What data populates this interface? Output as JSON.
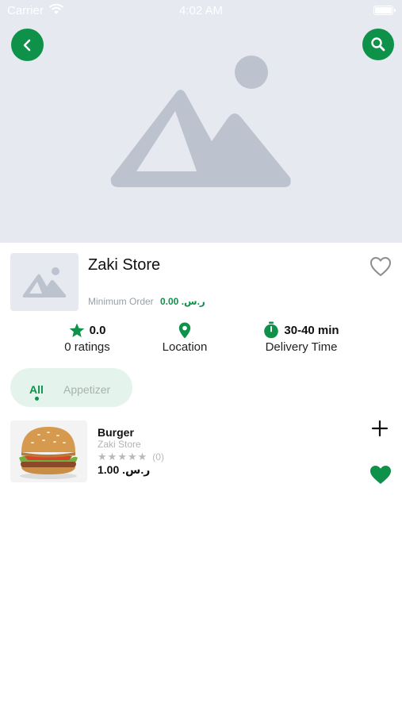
{
  "status_bar": {
    "carrier": "Carrier",
    "time": "4:02 AM"
  },
  "store": {
    "name": "Zaki Store",
    "min_order_label": "Minimum Order",
    "min_order_value": "0.00 .ر.س"
  },
  "stats": {
    "rating_value": "0.0",
    "rating_label": "0 ratings",
    "location_label": "Location",
    "delivery_value": "30-40 min",
    "delivery_label": "Delivery Time"
  },
  "tabs": [
    {
      "label": "All",
      "active": true
    },
    {
      "label": "Appetizer",
      "active": false
    }
  ],
  "product": {
    "name": "Burger",
    "store": "Zaki Store",
    "rating": 0,
    "max_rating": 5,
    "rating_count": "(0)",
    "price": "1.00 .ر.س",
    "favorited": true
  },
  "colors": {
    "accent": "#0e9149",
    "placeholder_bg": "#e6e9f0",
    "tab_bg": "#e4f4ec"
  },
  "icons": [
    "back-icon",
    "search-icon",
    "heart-outline-icon",
    "star-icon",
    "location-pin-icon",
    "timer-icon",
    "plus-icon",
    "heart-filled-icon"
  ]
}
